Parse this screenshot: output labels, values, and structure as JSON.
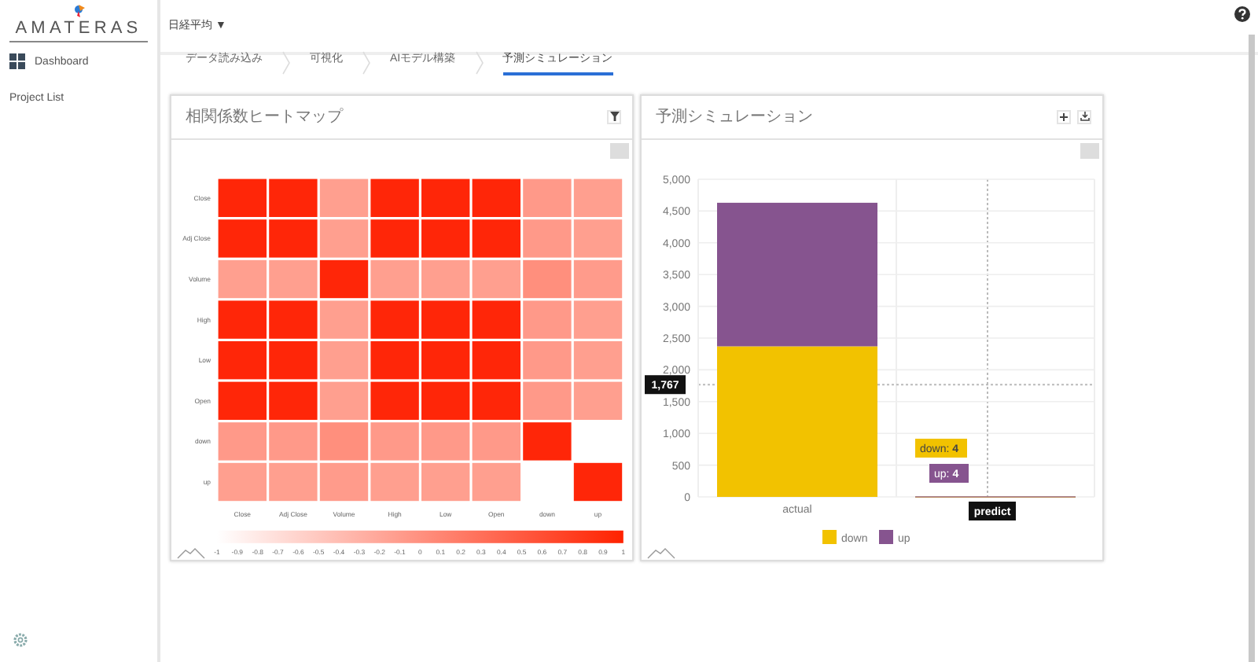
{
  "sidebar": {
    "logo": "AMATERAS",
    "items": [
      {
        "label": "Dashboard",
        "kind": "icon"
      },
      {
        "label": "Project List",
        "kind": "plain"
      }
    ]
  },
  "header": {
    "dataset": "日経平均 ▼",
    "steps": [
      {
        "label": "データ読み込み",
        "selected": false
      },
      {
        "label": "可視化",
        "selected": false
      },
      {
        "label": "AIモデル構築",
        "selected": false
      },
      {
        "label": "予測シミュレーション",
        "selected": true
      }
    ]
  },
  "heatmap_panel": {
    "title": "相関係数ヒートマップ",
    "columns": [
      "Close",
      "Adj Close",
      "Volume",
      "High",
      "Low",
      "Open",
      "down",
      "up"
    ],
    "rows": [
      {
        "label": "Close",
        "cells": [
          {
            "color": "#ff2608"
          },
          {
            "color": "#ff2608"
          },
          {
            "color": "#ff9f8f"
          },
          {
            "color": "#ff2608"
          },
          {
            "color": "#ff2608"
          },
          {
            "color": "#ff2608"
          },
          {
            "color": "#ff9989"
          },
          {
            "color": "#ff9f8f"
          }
        ]
      },
      {
        "label": "Adj Close",
        "cells": [
          {
            "color": "#ff2608"
          },
          {
            "color": "#ff2608"
          },
          {
            "color": "#ff9f8f"
          },
          {
            "color": "#ff2608"
          },
          {
            "color": "#ff2608"
          },
          {
            "color": "#ff2608"
          },
          {
            "color": "#ff9989"
          },
          {
            "color": "#ff9f8f"
          }
        ]
      },
      {
        "label": "Volume",
        "cells": [
          {
            "color": "#ff9f8f"
          },
          {
            "color": "#ff9f8f"
          },
          {
            "color": "#ff2608"
          },
          {
            "color": "#ff9f8f"
          },
          {
            "color": "#ff9f8f"
          },
          {
            "color": "#ff9f8f"
          },
          {
            "color": "#ff8f7d"
          },
          {
            "color": "#ff9b8b"
          }
        ]
      },
      {
        "label": "High",
        "cells": [
          {
            "color": "#ff2608"
          },
          {
            "color": "#ff2608"
          },
          {
            "color": "#ff9f8f"
          },
          {
            "color": "#ff2608"
          },
          {
            "color": "#ff2608"
          },
          {
            "color": "#ff2608"
          },
          {
            "color": "#ff9989"
          },
          {
            "color": "#ff9f8f"
          }
        ]
      },
      {
        "label": "Low",
        "cells": [
          {
            "color": "#ff2608"
          },
          {
            "color": "#ff2608"
          },
          {
            "color": "#ff9f8f"
          },
          {
            "color": "#ff2608"
          },
          {
            "color": "#ff2608"
          },
          {
            "color": "#ff2608"
          },
          {
            "color": "#ff9989"
          },
          {
            "color": "#ff9f8f"
          }
        ]
      },
      {
        "label": "Open",
        "cells": [
          {
            "color": "#ff2608"
          },
          {
            "color": "#ff2608"
          },
          {
            "color": "#ff9f8f"
          },
          {
            "color": "#ff2608"
          },
          {
            "color": "#ff2608"
          },
          {
            "color": "#ff2608"
          },
          {
            "color": "#ff9989"
          },
          {
            "color": "#ff9f8f"
          }
        ]
      },
      {
        "label": "down",
        "cells": [
          {
            "color": "#ff9989"
          },
          {
            "color": "#ff9989"
          },
          {
            "color": "#ff8f7d"
          },
          {
            "color": "#ff9989"
          },
          {
            "color": "#ff9989"
          },
          {
            "color": "#ff9989"
          },
          {
            "color": "#ff2608"
          },
          null
        ]
      },
      {
        "label": "up",
        "cells": [
          {
            "color": "#ff9f8f"
          },
          {
            "color": "#ff9f8f"
          },
          {
            "color": "#ff9b8b"
          },
          {
            "color": "#ff9f8f"
          },
          {
            "color": "#ff9f8f"
          },
          {
            "color": "#ff9f8f"
          },
          null,
          {
            "color": "#ff2608"
          }
        ]
      }
    ],
    "scale_ticks": [
      "-1",
      "-0.9",
      "-0.8",
      "-0.7",
      "-0.6",
      "-0.5",
      "-0.4",
      "-0.3",
      "-0.2",
      "-0.1",
      "0",
      "0.1",
      "0.2",
      "0.3",
      "0.4",
      "0.5",
      "0.6",
      "0.7",
      "0.8",
      "0.9",
      "1"
    ]
  },
  "simulation_panel": {
    "title": "予測シミュレーション",
    "chart_data": {
      "type": "bar",
      "stacked": true,
      "grid": true,
      "legend": "bottom",
      "categories": [
        "actual",
        "predict"
      ],
      "series": [
        {
          "name": "down",
          "color": "#f2c200",
          "values": [
            2370,
            4
          ]
        },
        {
          "name": "up",
          "color": "#86548f",
          "values": [
            2260,
            4
          ]
        }
      ],
      "ylim": [
        0,
        5000
      ],
      "yticks": [
        {
          "value": 0,
          "label": "0"
        },
        {
          "value": 500,
          "label": "500"
        },
        {
          "value": 1000,
          "label": "1,000"
        },
        {
          "value": 1500,
          "label": "1,500"
        },
        {
          "value": 2000,
          "label": "2,000"
        },
        {
          "value": 2500,
          "label": "2,500"
        },
        {
          "value": 3000,
          "label": "3,000"
        },
        {
          "value": 3500,
          "label": "3,500"
        },
        {
          "value": 4000,
          "label": "4,000"
        },
        {
          "value": 4500,
          "label": "4,500"
        },
        {
          "value": 5000,
          "label": "5,000"
        }
      ]
    },
    "crosshair_label": "1,767",
    "tooltips": [
      "down: **4**",
      "up: **4**"
    ]
  }
}
